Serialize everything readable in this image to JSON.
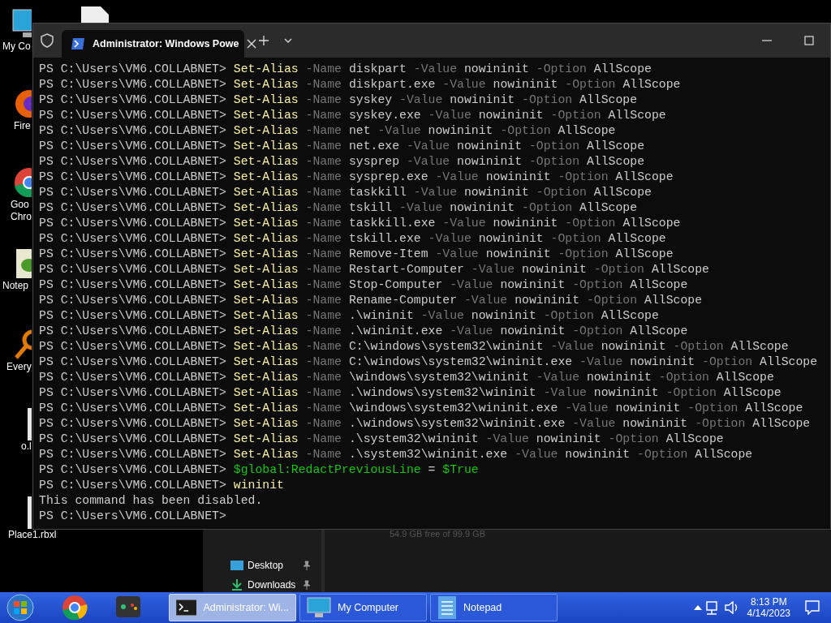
{
  "desktop_icons": [
    {
      "label": "My Co"
    },
    {
      "label": "Fire"
    },
    {
      "label": "Goo\nChro"
    },
    {
      "label": "Notep"
    },
    {
      "label": "Every"
    },
    {
      "label": "o.l"
    },
    {
      "label": "Place1.rbxl"
    }
  ],
  "explorer": {
    "storage": "54.9 GB free of 99.9 GB",
    "nav_items": [
      {
        "label": "Desktop"
      },
      {
        "label": "Downloads"
      }
    ]
  },
  "terminal": {
    "tab_title": "Administrator: Windows Powe",
    "lines": [
      [
        {
          "kind": "prompt",
          "text": "PS C:\\Users\\VM6.COLLABNET>"
        },
        {
          "kind": "cmd",
          "text": "Set-Alias"
        },
        {
          "kind": "param",
          "text": "-Name"
        },
        {
          "kind": "arg",
          "text": "diskpart"
        },
        {
          "kind": "param",
          "text": "-Value"
        },
        {
          "kind": "arg",
          "text": "nowininit"
        },
        {
          "kind": "param",
          "text": "-Option"
        },
        {
          "kind": "arg",
          "text": "AllScope"
        }
      ],
      [
        {
          "kind": "prompt",
          "text": "PS C:\\Users\\VM6.COLLABNET>"
        },
        {
          "kind": "cmd",
          "text": "Set-Alias"
        },
        {
          "kind": "param",
          "text": "-Name"
        },
        {
          "kind": "arg",
          "text": "diskpart.exe"
        },
        {
          "kind": "param",
          "text": "-Value"
        },
        {
          "kind": "arg",
          "text": "nowininit"
        },
        {
          "kind": "param",
          "text": "-Option"
        },
        {
          "kind": "arg",
          "text": "AllScope"
        }
      ],
      [
        {
          "kind": "prompt",
          "text": "PS C:\\Users\\VM6.COLLABNET>"
        },
        {
          "kind": "cmd",
          "text": "Set-Alias"
        },
        {
          "kind": "param",
          "text": "-Name"
        },
        {
          "kind": "arg",
          "text": "syskey"
        },
        {
          "kind": "param",
          "text": "-Value"
        },
        {
          "kind": "arg",
          "text": "nowininit"
        },
        {
          "kind": "param",
          "text": "-Option"
        },
        {
          "kind": "arg",
          "text": "AllScope"
        }
      ],
      [
        {
          "kind": "prompt",
          "text": "PS C:\\Users\\VM6.COLLABNET>"
        },
        {
          "kind": "cmd",
          "text": "Set-Alias"
        },
        {
          "kind": "param",
          "text": "-Name"
        },
        {
          "kind": "arg",
          "text": "syskey.exe"
        },
        {
          "kind": "param",
          "text": "-Value"
        },
        {
          "kind": "arg",
          "text": "nowininit"
        },
        {
          "kind": "param",
          "text": "-Option"
        },
        {
          "kind": "arg",
          "text": "AllScope"
        }
      ],
      [
        {
          "kind": "prompt",
          "text": "PS C:\\Users\\VM6.COLLABNET>"
        },
        {
          "kind": "cmd",
          "text": "Set-Alias"
        },
        {
          "kind": "param",
          "text": "-Name"
        },
        {
          "kind": "arg",
          "text": "net"
        },
        {
          "kind": "param",
          "text": "-Value"
        },
        {
          "kind": "arg",
          "text": "nowininit"
        },
        {
          "kind": "param",
          "text": "-Option"
        },
        {
          "kind": "arg",
          "text": "AllScope"
        }
      ],
      [
        {
          "kind": "prompt",
          "text": "PS C:\\Users\\VM6.COLLABNET>"
        },
        {
          "kind": "cmd",
          "text": "Set-Alias"
        },
        {
          "kind": "param",
          "text": "-Name"
        },
        {
          "kind": "arg",
          "text": "net.exe"
        },
        {
          "kind": "param",
          "text": "-Value"
        },
        {
          "kind": "arg",
          "text": "nowininit"
        },
        {
          "kind": "param",
          "text": "-Option"
        },
        {
          "kind": "arg",
          "text": "AllScope"
        }
      ],
      [
        {
          "kind": "prompt",
          "text": "PS C:\\Users\\VM6.COLLABNET>"
        },
        {
          "kind": "cmd",
          "text": "Set-Alias"
        },
        {
          "kind": "param",
          "text": "-Name"
        },
        {
          "kind": "arg",
          "text": "sysprep"
        },
        {
          "kind": "param",
          "text": "-Value"
        },
        {
          "kind": "arg",
          "text": "nowininit"
        },
        {
          "kind": "param",
          "text": "-Option"
        },
        {
          "kind": "arg",
          "text": "AllScope"
        }
      ],
      [
        {
          "kind": "prompt",
          "text": "PS C:\\Users\\VM6.COLLABNET>"
        },
        {
          "kind": "cmd",
          "text": "Set-Alias"
        },
        {
          "kind": "param",
          "text": "-Name"
        },
        {
          "kind": "arg",
          "text": "sysprep.exe"
        },
        {
          "kind": "param",
          "text": "-Value"
        },
        {
          "kind": "arg",
          "text": "nowininit"
        },
        {
          "kind": "param",
          "text": "-Option"
        },
        {
          "kind": "arg",
          "text": "AllScope"
        }
      ],
      [
        {
          "kind": "prompt",
          "text": "PS C:\\Users\\VM6.COLLABNET>"
        },
        {
          "kind": "cmd",
          "text": "Set-Alias"
        },
        {
          "kind": "param",
          "text": "-Name"
        },
        {
          "kind": "arg",
          "text": "taskkill"
        },
        {
          "kind": "param",
          "text": "-Value"
        },
        {
          "kind": "arg",
          "text": "nowininit"
        },
        {
          "kind": "param",
          "text": "-Option"
        },
        {
          "kind": "arg",
          "text": "AllScope"
        }
      ],
      [
        {
          "kind": "prompt",
          "text": "PS C:\\Users\\VM6.COLLABNET>"
        },
        {
          "kind": "cmd",
          "text": "Set-Alias"
        },
        {
          "kind": "param",
          "text": "-Name"
        },
        {
          "kind": "arg",
          "text": "tskill"
        },
        {
          "kind": "param",
          "text": "-Value"
        },
        {
          "kind": "arg",
          "text": "nowininit"
        },
        {
          "kind": "param",
          "text": "-Option"
        },
        {
          "kind": "arg",
          "text": "AllScope"
        }
      ],
      [
        {
          "kind": "prompt",
          "text": "PS C:\\Users\\VM6.COLLABNET>"
        },
        {
          "kind": "cmd",
          "text": "Set-Alias"
        },
        {
          "kind": "param",
          "text": "-Name"
        },
        {
          "kind": "arg",
          "text": "taskkill.exe"
        },
        {
          "kind": "param",
          "text": "-Value"
        },
        {
          "kind": "arg",
          "text": "nowininit"
        },
        {
          "kind": "param",
          "text": "-Option"
        },
        {
          "kind": "arg",
          "text": "AllScope"
        }
      ],
      [
        {
          "kind": "prompt",
          "text": "PS C:\\Users\\VM6.COLLABNET>"
        },
        {
          "kind": "cmd",
          "text": "Set-Alias"
        },
        {
          "kind": "param",
          "text": "-Name"
        },
        {
          "kind": "arg",
          "text": "tskill.exe"
        },
        {
          "kind": "param",
          "text": "-Value"
        },
        {
          "kind": "arg",
          "text": "nowininit"
        },
        {
          "kind": "param",
          "text": "-Option"
        },
        {
          "kind": "arg",
          "text": "AllScope"
        }
      ],
      [
        {
          "kind": "prompt",
          "text": "PS C:\\Users\\VM6.COLLABNET>"
        },
        {
          "kind": "cmd",
          "text": "Set-Alias"
        },
        {
          "kind": "param",
          "text": "-Name"
        },
        {
          "kind": "arg",
          "text": "Remove-Item"
        },
        {
          "kind": "param",
          "text": "-Value"
        },
        {
          "kind": "arg",
          "text": "nowininit"
        },
        {
          "kind": "param",
          "text": "-Option"
        },
        {
          "kind": "arg",
          "text": "AllScope"
        }
      ],
      [
        {
          "kind": "prompt",
          "text": "PS C:\\Users\\VM6.COLLABNET>"
        },
        {
          "kind": "cmd",
          "text": "Set-Alias"
        },
        {
          "kind": "param",
          "text": "-Name"
        },
        {
          "kind": "arg",
          "text": "Restart-Computer"
        },
        {
          "kind": "param",
          "text": "-Value"
        },
        {
          "kind": "arg",
          "text": "nowininit"
        },
        {
          "kind": "param",
          "text": "-Option"
        },
        {
          "kind": "arg",
          "text": "AllScope"
        }
      ],
      [
        {
          "kind": "prompt",
          "text": "PS C:\\Users\\VM6.COLLABNET>"
        },
        {
          "kind": "cmd",
          "text": "Set-Alias"
        },
        {
          "kind": "param",
          "text": "-Name"
        },
        {
          "kind": "arg",
          "text": "Stop-Computer"
        },
        {
          "kind": "param",
          "text": "-Value"
        },
        {
          "kind": "arg",
          "text": "nowininit"
        },
        {
          "kind": "param",
          "text": "-Option"
        },
        {
          "kind": "arg",
          "text": "AllScope"
        }
      ],
      [
        {
          "kind": "prompt",
          "text": "PS C:\\Users\\VM6.COLLABNET>"
        },
        {
          "kind": "cmd",
          "text": "Set-Alias"
        },
        {
          "kind": "param",
          "text": "-Name"
        },
        {
          "kind": "arg",
          "text": "Rename-Computer"
        },
        {
          "kind": "param",
          "text": "-Value"
        },
        {
          "kind": "arg",
          "text": "nowininit"
        },
        {
          "kind": "param",
          "text": "-Option"
        },
        {
          "kind": "arg",
          "text": "AllScope"
        }
      ],
      [
        {
          "kind": "prompt",
          "text": "PS C:\\Users\\VM6.COLLABNET>"
        },
        {
          "kind": "cmd",
          "text": "Set-Alias"
        },
        {
          "kind": "param",
          "text": "-Name"
        },
        {
          "kind": "arg",
          "text": ".\\wininit"
        },
        {
          "kind": "param",
          "text": "-Value"
        },
        {
          "kind": "arg",
          "text": "nowininit"
        },
        {
          "kind": "param",
          "text": "-Option"
        },
        {
          "kind": "arg",
          "text": "AllScope"
        }
      ],
      [
        {
          "kind": "prompt",
          "text": "PS C:\\Users\\VM6.COLLABNET>"
        },
        {
          "kind": "cmd",
          "text": "Set-Alias"
        },
        {
          "kind": "param",
          "text": "-Name"
        },
        {
          "kind": "arg",
          "text": ".\\wininit.exe"
        },
        {
          "kind": "param",
          "text": "-Value"
        },
        {
          "kind": "arg",
          "text": "nowininit"
        },
        {
          "kind": "param",
          "text": "-Option"
        },
        {
          "kind": "arg",
          "text": "AllScope"
        }
      ],
      [
        {
          "kind": "prompt",
          "text": "PS C:\\Users\\VM6.COLLABNET>"
        },
        {
          "kind": "cmd",
          "text": "Set-Alias"
        },
        {
          "kind": "param",
          "text": "-Name"
        },
        {
          "kind": "arg",
          "text": "C:\\windows\\system32\\wininit"
        },
        {
          "kind": "param",
          "text": "-Value"
        },
        {
          "kind": "arg",
          "text": "nowininit"
        },
        {
          "kind": "param",
          "text": "-Option"
        },
        {
          "kind": "arg",
          "text": "AllScope"
        }
      ],
      [
        {
          "kind": "prompt",
          "text": "PS C:\\Users\\VM6.COLLABNET>"
        },
        {
          "kind": "cmd",
          "text": "Set-Alias"
        },
        {
          "kind": "param",
          "text": "-Name"
        },
        {
          "kind": "arg",
          "text": "C:\\windows\\system32\\wininit.exe"
        },
        {
          "kind": "param",
          "text": "-Value"
        },
        {
          "kind": "arg",
          "text": "nowininit"
        },
        {
          "kind": "param",
          "text": "-Option"
        },
        {
          "kind": "arg",
          "text": "AllScope"
        }
      ],
      [
        {
          "kind": "prompt",
          "text": "PS C:\\Users\\VM6.COLLABNET>"
        },
        {
          "kind": "cmd",
          "text": "Set-Alias"
        },
        {
          "kind": "param",
          "text": "-Name"
        },
        {
          "kind": "arg",
          "text": "\\windows\\system32\\wininit"
        },
        {
          "kind": "param",
          "text": "-Value"
        },
        {
          "kind": "arg",
          "text": "nowininit"
        },
        {
          "kind": "param",
          "text": "-Option"
        },
        {
          "kind": "arg",
          "text": "AllScope"
        }
      ],
      [
        {
          "kind": "prompt",
          "text": "PS C:\\Users\\VM6.COLLABNET>"
        },
        {
          "kind": "cmd",
          "text": "Set-Alias"
        },
        {
          "kind": "param",
          "text": "-Name"
        },
        {
          "kind": "arg",
          "text": ".\\windows\\system32\\wininit"
        },
        {
          "kind": "param",
          "text": "-Value"
        },
        {
          "kind": "arg",
          "text": "nowininit"
        },
        {
          "kind": "param",
          "text": "-Option"
        },
        {
          "kind": "arg",
          "text": "AllScope"
        }
      ],
      [
        {
          "kind": "prompt",
          "text": "PS C:\\Users\\VM6.COLLABNET>"
        },
        {
          "kind": "cmd",
          "text": "Set-Alias"
        },
        {
          "kind": "param",
          "text": "-Name"
        },
        {
          "kind": "arg",
          "text": "\\windows\\system32\\wininit.exe"
        },
        {
          "kind": "param",
          "text": "-Value"
        },
        {
          "kind": "arg",
          "text": "nowininit"
        },
        {
          "kind": "param",
          "text": "-Option"
        },
        {
          "kind": "arg",
          "text": "AllScope"
        }
      ],
      [
        {
          "kind": "prompt",
          "text": "PS C:\\Users\\VM6.COLLABNET>"
        },
        {
          "kind": "cmd",
          "text": "Set-Alias"
        },
        {
          "kind": "param",
          "text": "-Name"
        },
        {
          "kind": "arg",
          "text": ".\\windows\\system32\\wininit.exe"
        },
        {
          "kind": "param",
          "text": "-Value"
        },
        {
          "kind": "arg",
          "text": "nowininit"
        },
        {
          "kind": "param",
          "text": "-Option"
        },
        {
          "kind": "arg",
          "text": "AllScope"
        }
      ],
      [
        {
          "kind": "prompt",
          "text": "PS C:\\Users\\VM6.COLLABNET>"
        },
        {
          "kind": "cmd",
          "text": "Set-Alias"
        },
        {
          "kind": "param",
          "text": "-Name"
        },
        {
          "kind": "arg",
          "text": ".\\system32\\wininit"
        },
        {
          "kind": "param",
          "text": "-Value"
        },
        {
          "kind": "arg",
          "text": "nowininit"
        },
        {
          "kind": "param",
          "text": "-Option"
        },
        {
          "kind": "arg",
          "text": "AllScope"
        }
      ],
      [
        {
          "kind": "prompt",
          "text": "PS C:\\Users\\VM6.COLLABNET>"
        },
        {
          "kind": "cmd",
          "text": "Set-Alias"
        },
        {
          "kind": "param",
          "text": "-Name"
        },
        {
          "kind": "arg",
          "text": ".\\system32\\wininit.exe"
        },
        {
          "kind": "param",
          "text": "-Value"
        },
        {
          "kind": "arg",
          "text": "nowininit"
        },
        {
          "kind": "param",
          "text": "-Option"
        },
        {
          "kind": "arg",
          "text": "AllScope"
        }
      ],
      [
        {
          "kind": "prompt",
          "text": "PS C:\\Users\\VM6.COLLABNET>"
        },
        {
          "kind": "var",
          "text": "$global:RedactPreviousLine"
        },
        {
          "kind": "op",
          "text": "="
        },
        {
          "kind": "var",
          "text": "$True"
        }
      ],
      [
        {
          "kind": "prompt",
          "text": "PS C:\\Users\\VM6.COLLABNET>"
        },
        {
          "kind": "cmd",
          "text": "wininit"
        }
      ],
      [
        {
          "kind": "output",
          "text": "This command has been disabled."
        }
      ],
      [
        {
          "kind": "prompt",
          "text": "PS C:\\Users\\VM6.COLLABNET>"
        }
      ]
    ]
  },
  "taskbar": {
    "tasks": [
      {
        "label": "Administrator: Wi...",
        "kind": "terminal",
        "selected": true
      },
      {
        "label": "My Computer",
        "kind": "computer",
        "selected": false
      },
      {
        "label": "Notepad",
        "kind": "notepad",
        "selected": false
      }
    ],
    "time": "8:13 PM",
    "date": "4/14/2023"
  }
}
